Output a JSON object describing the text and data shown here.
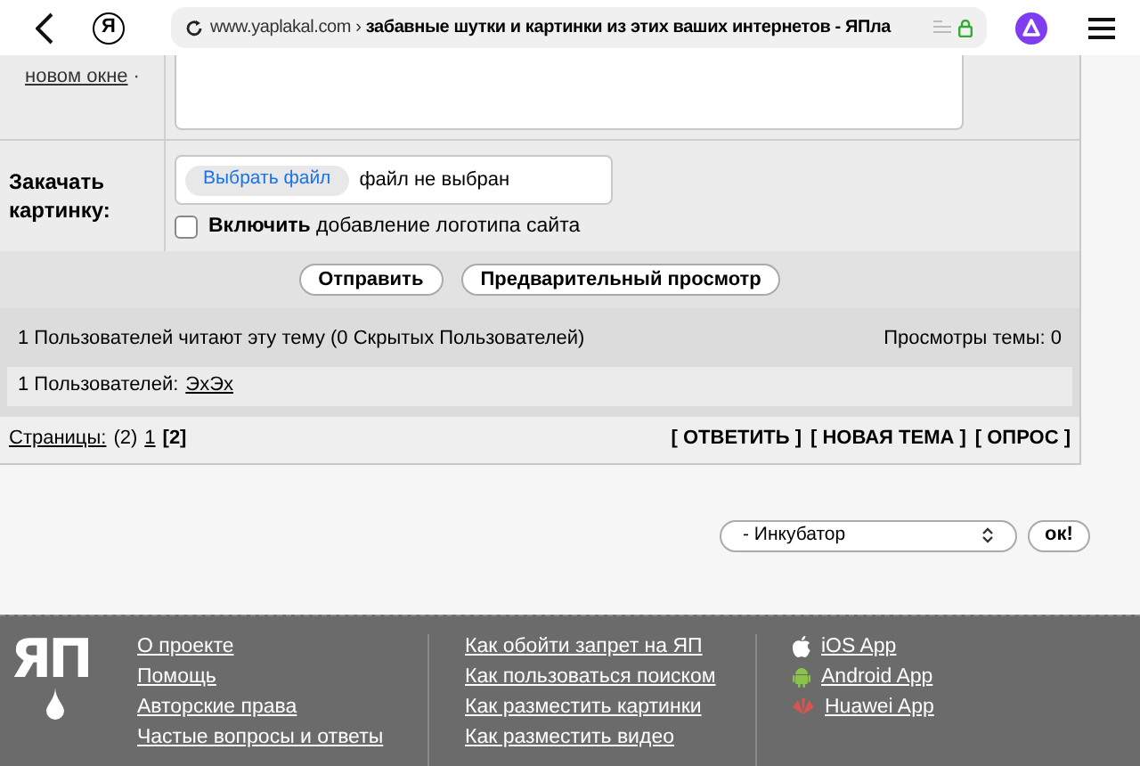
{
  "browser": {
    "logo_letter": "Я",
    "url_domain": "www.yaplakal.com",
    "url_separator": "›",
    "page_title": "забавные шутки и картинки из этих ваших интернетов - ЯПла"
  },
  "form": {
    "side_link": "новом окне",
    "side_link_suffix": "·",
    "upload_label": "Закачать картинку:",
    "file_button": "Выбрать файл",
    "file_status": "файл не выбран",
    "logo_option": {
      "checked": false,
      "bold": "Включить",
      "text": "добавление логотипа сайта"
    },
    "buttons": [
      "Отправить",
      "Предварительный просмотр"
    ]
  },
  "readers": {
    "summary": "1 Пользователей читают эту тему (0 Скрытых Пользователей)",
    "views": "Просмотры темы: 0",
    "users_label": "1 Пользователей:",
    "users": [
      "ЭхЭх"
    ]
  },
  "pages": {
    "label": "Страницы:",
    "count": "(2)",
    "items": [
      {
        "label": "1",
        "selected": false
      },
      {
        "label": "[2]",
        "selected": true
      }
    ],
    "actions": [
      "[ ОТВЕТИТЬ ]",
      "[ НОВАЯ ТЕМА ]",
      "[ ОПРОС ]"
    ]
  },
  "jump": {
    "value": "- Инкубатор",
    "button": "ок!"
  },
  "footer": {
    "logo": "ЯП",
    "columns": [
      {
        "links": [
          {
            "label": "О проекте"
          },
          {
            "label": "Помощь"
          },
          {
            "label": "Авторские права"
          },
          {
            "label": "Частые вопросы и ответы"
          }
        ]
      },
      {
        "links": [
          {
            "label": "Как обойти запрет на ЯП"
          },
          {
            "label": "Как пользоваться поиском"
          },
          {
            "label": "Как разместить картинки"
          },
          {
            "label": "Как разместить видео"
          }
        ]
      },
      {
        "links": [
          {
            "label": "iOS App",
            "kind": "apple"
          },
          {
            "label": "Android App",
            "kind": "android"
          },
          {
            "label": "Huawei App",
            "kind": "huawei"
          }
        ]
      }
    ]
  }
}
